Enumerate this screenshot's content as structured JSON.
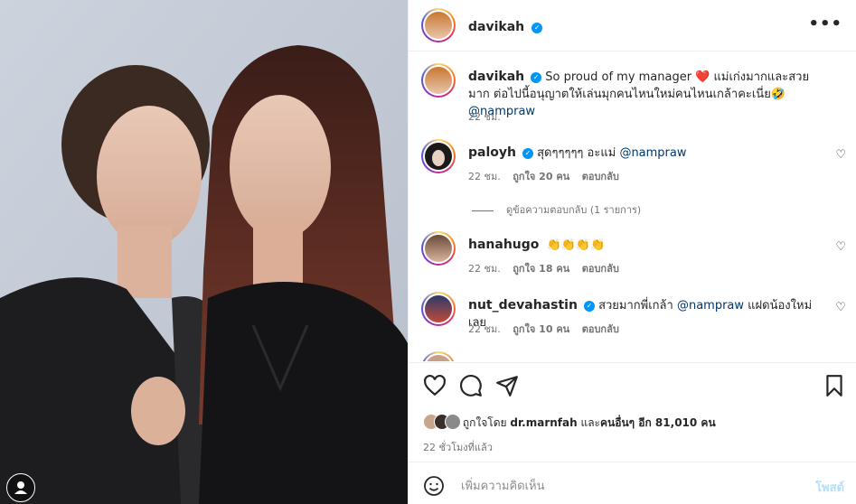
{
  "post": {
    "author": "davikah"
  },
  "caption": {
    "username": "davikah",
    "text_before": "So proud of my manager ❤️ แม่เก่งมากและสวยมาก ต่อไปนี้อนุญาตให้เล่นมุกคนไหนใหม่คนไหนเกล้าคะเนี่ย🤣",
    "mention": "@nampraw",
    "time": "22 ชม."
  },
  "comments": [
    {
      "username": "paloyh",
      "verified": true,
      "text": "สุดๆๆๆๆๆ อะแม่",
      "mention": "@nampraw",
      "text_after": "",
      "time": "22 ชม.",
      "likes": "ถูกใจ 20 คน",
      "reply": "ตอบกลับ"
    },
    {
      "username": "hanahugo",
      "verified": false,
      "text": "👏👏👏👏",
      "mention": "",
      "text_after": "",
      "time": "22 ชม.",
      "likes": "ถูกใจ 18 คน",
      "reply": "ตอบกลับ"
    },
    {
      "username": "nut_devahastin",
      "verified": true,
      "text": "สวยมากพี่เกล้า",
      "mention": "@nampraw",
      "text_after": "แฝดน้องใหม่เลย",
      "time": "22 ชม.",
      "likes": "ถูกใจ 10 คน",
      "reply": "ตอบกลับ"
    }
  ],
  "view_replies": "ดูข้อความตอบกลับ (1 รายการ)",
  "likes_line": {
    "prefix": "ถูกใจโดย",
    "user": "dr.marnfah",
    "middle": "และ",
    "others": "คนอื่นๆ อีก 81,010 คน"
  },
  "time_ago": "22 ชั่วโมงที่แล้ว",
  "add_comment": {
    "placeholder": "เพิ่มความคิดเห็น",
    "post_label": "โพสต์"
  },
  "icons": {
    "more": "more-horizontal-icon",
    "like": "heart-icon",
    "comment": "comment-icon",
    "share": "send-icon",
    "save": "bookmark-icon",
    "emoji": "emoji-icon",
    "verified": "verified-badge-icon"
  },
  "colors": {
    "verified": "#0095f6",
    "mention": "#00376b",
    "muted": "#737373",
    "post_disabled": "#b2dffc"
  }
}
